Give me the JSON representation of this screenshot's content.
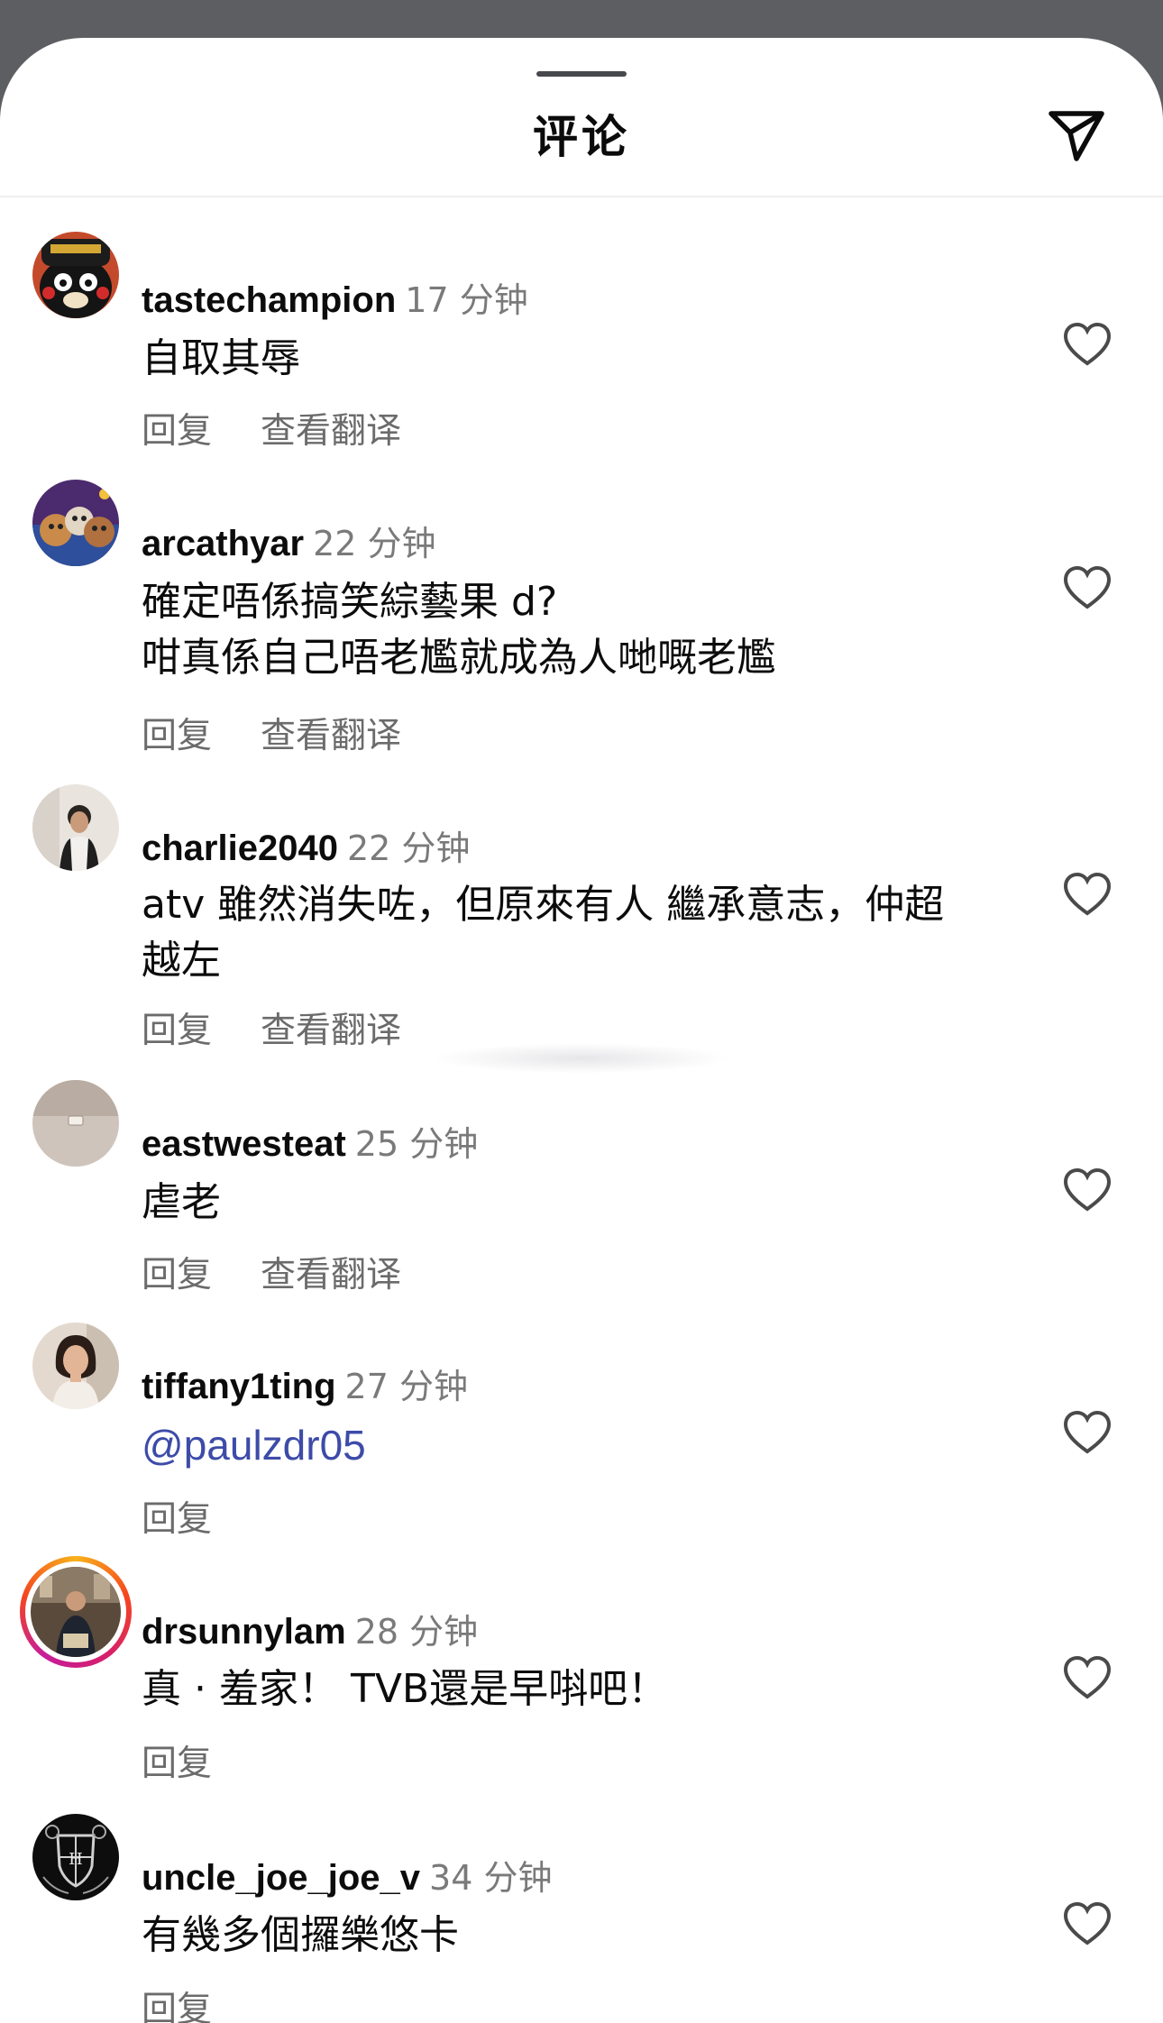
{
  "header": {
    "title": "评论"
  },
  "comments": [
    {
      "username": "tastechampion",
      "time": "17 分钟",
      "text": "自取其辱",
      "reply": "回复",
      "translate": "查看翻译",
      "avatar": "kumamon-cap-avatar"
    },
    {
      "username": "arcathyar",
      "time": "22 分钟",
      "text": "確定唔係搞笑綜藝果 d?\n咁真係自己唔老尷就成為人哋嘅老尷",
      "reply": "回复",
      "translate": "查看翻译",
      "avatar": "cats-avatar"
    },
    {
      "username": "charlie2040",
      "time": "22 分钟",
      "text": "atv 雖然消失咗，但原來有人 繼承意志，仲超\n越左",
      "reply": "回复",
      "translate": "查看翻译",
      "avatar": "person-selfie-avatar"
    },
    {
      "username": "eastwesteat",
      "time": "25 分钟",
      "text": "虐老",
      "reply": "回复",
      "translate": "查看翻译",
      "avatar": "wall-avatar"
    },
    {
      "username": "tiffany1ting",
      "time": "27 分钟",
      "text": "@paulzdr05",
      "reply": "回复",
      "translate": "",
      "avatar": "woman-portrait-avatar"
    },
    {
      "username": "drsunnylam",
      "time": "28 分钟",
      "text": "真 · 羞家！ TVB還是早唞吧！",
      "reply": "回复",
      "translate": "",
      "avatar": "story-ring-avatar"
    },
    {
      "username": "uncle_joe_joe_v",
      "time": "34 分钟",
      "text": "有幾多個攞樂悠卡",
      "reply": "回复",
      "translate": "",
      "avatar": "crest-avatar"
    }
  ],
  "colors": {
    "mention": "#3d4ba8",
    "secondary_text": "#7a7a7a",
    "backdrop": "#5d5e61"
  }
}
